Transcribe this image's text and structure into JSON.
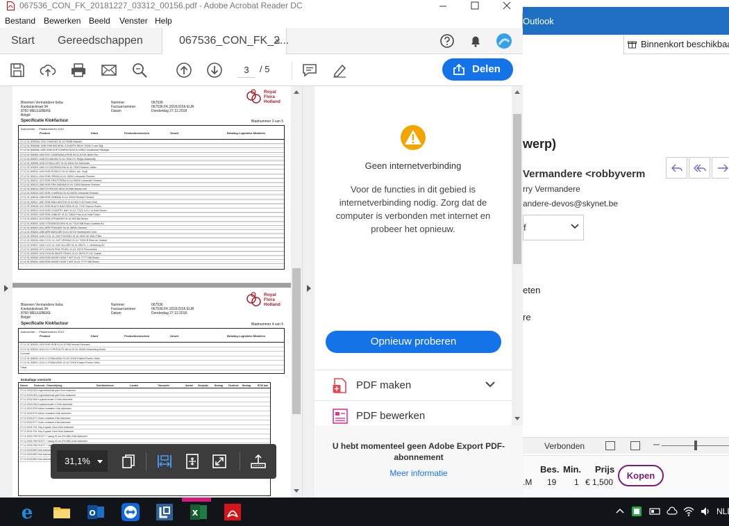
{
  "acrobat": {
    "window_title": "067536_CON_FK_20181227_03312_00156.pdf - Adobe Acrobat Reader DC",
    "menu": [
      "Bestand",
      "Bewerken",
      "Beeld",
      "Venster",
      "Help"
    ],
    "tabs": {
      "start": "Start",
      "tools": "Gereedschappen",
      "doc": "067536_CON_FK_2...",
      "close": "×"
    },
    "page": {
      "current": "3",
      "total": "/ 5"
    },
    "share_label": "Delen",
    "zoom": "31,1%"
  },
  "invoice": {
    "company": [
      "Bloemen Vermandere bvba",
      "Kastanjestraat 34",
      "8760 MEULEBEKE",
      "België"
    ],
    "meta_labels": [
      "Nummer",
      "Factuurnummer",
      "Datum"
    ],
    "meta_values": [
      "067536",
      "067536.FK.2018.0156 EUR",
      "Donderdag 27.12.2018"
    ],
    "title": "Specificatie Klokfactuur",
    "logo": [
      "Royal",
      "Flora",
      "Holland"
    ],
    "page1_label": "Bladnummer 3 van 5",
    "page2_label": "Bladnummer 4 van 5",
    "section_header": "Aanvoerder ... Plaatsnummer 2012",
    "col_groups": [
      "Product",
      "Klant",
      "Productkenmerken",
      "Omzet",
      "Betaling Logistieke Middelen"
    ],
    "rows_p1": [
      "27.12 01 005305a 1334 CHAM ADI 91 A2 90085 Markant",
      "27.12 01 005305b 1038 CHM NATURAL COUNTRY 88 A2 70006 C.van Gijlij",
      "27.12 01 005305c 1052 CHM CHP COMPACTA 92 A1 29512 Crudbenkel Flanegal",
      "27.12 01 005306 1054 ROC CAMPANULA PINK 83 A1 87101 Bella Flori",
      "27.12 01 005307 1048 CH MALIBU 91 A1 78410 Fr. Reijps Wasserdijl",
      "27.12 01 005308 1045 CH BALLURY 91 A1 84011 Bz Schreuder",
      "27.12 01 005309 1083 CH DOORBIDONA 91 A1 76000 Bekees Jablen",
      "27.12 01 005310 1039 ROB ROSECO 91 A1 80041 Jas. Oudji",
      "27.12 01 005311 1054 ROB ORNSA 91 A1 34000 Lebrandts Primees",
      "27.12 01 005312 1072 ROB FRA ETERNA 91 A1 86000 Lebrandts Primees",
      "27.12 01 005313 1062 ROB FRA SARANA 91 A1 13000 Bloemer Primees",
      "27.12 01 005314 1054 CH ROUGE 88 A1 84 Mali dansen bvb",
      "27.12 01 005315 1037 ROB CHAPEAU 91 A1 84000 Lebrandts Primees",
      "27.12 01 005316 1085 ROB ORBANA 91 A1 20000 Rinafiel Primees",
      "27.12 01 005317 1087 ROB WALLINGTON 91 A1 86171 B Flower Hold",
      "27.12 01 005318 1021 ROB BLACK BACCARA 91 A1 77047 Asmon Rosen",
      "27.12 01 005319 1019 ROB COUNTRY WAY 91 A1 77121 A.S.C et Holel Rosen",
      "27.12 01 005320 1030 ROB JUBILEE 91 A1 23600 Prad et al Holel Rosen",
      "27.12 01 005321 1013 ROB STRANGER 91 A1 803 Bal Rosen",
      "27.12 01 005322 1030 CTEDERION DRA 91 A1 73120 Bill Rose Goddess BV",
      "27.12 01 005323 1021 ARR FRAGANT 91 A1 28005 Osbrand",
      "27.12 01 005324 1086 ARR MARCARI 91 A1 92719 Vantenij den Oord",
      "27.12 01 005325 1046 CYCL KL SUP PICASSO 91 A1 5000 Ter Veen Plant",
      "27.12 01 005326 1081 CYCL KL SUP VERANO 91 A1 73000 B Elfan de Omstad",
      "27.12 01 005327 1030 CYCL KL SUP ALLURE 91 A1 283 P.L.J. Vederburg BV",
      "27.12 01 005328 1072 HYACIN PINK PEARL 91 A1 70070 Pinnenbeek",
      "27.12 01 005329 1015 HYACIN WHITE PEARL 91 A1 35370 R.J.M. Duinen",
      "27.12 01 005330 1009 ROB MONEY BOM T WIT 91 A1 77777 Bill Rosen",
      "27.12 01 005331 1009 ROB MONEY BOM T WIT 91 A1 77777 Bill Rosen"
    ],
    "rows_p2": [
      "27.12 01 005332 1020 ROB ROB 91 A1 87098 Hoeksij Denmark",
      "27.12 01 005333 1034 CH CYPER ALTS MELA 91 A1 30025 Gedenberg Kreek",
      "Correctie",
      "27.12 01 006520 1194 LI OTWALDING 91 A2 07400 Roland Florelo Vides",
      "27.12 01 006521 1194 LI OTWALDING 91 A2 07400 Roland Florelo Vides",
      "Totaal"
    ],
    "emb_title": "Emballage overzicht",
    "emb_cols": [
      "Datum",
      "Fustcode",
      "Omschrijving",
      "Distributiemod",
      "Locatie",
      "Transactie",
      "Aantal",
      "Stukprijs",
      "Bedrag",
      "Fustkost",
      "Bedrag",
      "BTW bas"
    ],
    "emb_rows": [
      "27.12.2018 003 Legendisvelzak gele Klok Aalsmeer",
      "27.12.2018 003 Legendisvelzak gele Klok Aalsmeer",
      "27.12.2018 006 Kopstukvonden 3 Klok Aalsmeer",
      "27.12.2018 006 Kopstukvonden 3 Klok Aalsmeer",
      "27.12.2018 578 Kleine container Klok Aalsmeer",
      "27.12.2018 573 Kleine container Klok Aalsmeer",
      "27.12.2018 577 Grote container Klok Aalsmeer",
      "27.12.2018 577 Grote container Klok Aalsmeer",
      "27.12.2018 794 Tray 6 gaats 13cm Klok Aalsmeer",
      "27.12.2018 794 Tray 6 gaats 13cm Klok Aalsmeer",
      "27.12.2018 795 FA 577 + stang 30 cm (Pe 880) Klok Aalsmeer",
      "27.12.2018 795 FA 577 + stang 30 cm (Pe 880) Klok Aalsmeer",
      "27.12.2018 795 FA 577 + stang 30 cm (Pe 880) Klok Aalsmeer",
      "27.12.2018 890 Klok Aalsmeer",
      "27.12.2018 890 Klok Aalsmeer",
      "27.12.2018 890 Klok Aalsmeer"
    ]
  },
  "panel": {
    "warning_title": "Geen internetverbinding",
    "warning_msg": "Voor de functies in dit gebied is internetverbinding nodig. Zorg dat de computer is verbonden met internet en probeer het opnieuw.",
    "retry_label": "Opnieuw proberen",
    "tools": [
      "PDF maken",
      "PDF bewerken"
    ],
    "subscription_note": "U hebt momenteel geen Adobe Export PDF-abonnement",
    "more_info": "Meer informatie"
  },
  "outlook": {
    "title": "Outlook",
    "info": "Binnenkort beschikbaa",
    "subject_fragment": "werp)",
    "sender_fragment": "Vermandere <robbyverm",
    "line1": "rry Vermandere",
    "line2": "andere-devos@skynet.be",
    "dropdown_value": "f",
    "word1": "eten",
    "word2": "re",
    "status": "Verbonden",
    "product_headers": [
      "Bes.",
      "Min.",
      "Prijs"
    ],
    "product_values": [
      ".M",
      "19",
      "1",
      "€ 1,500"
    ],
    "buy_label": "Kopen"
  },
  "taskbar": {
    "language": "NLD"
  },
  "colors": {
    "accent": "#1473e6",
    "outlook_blue": "#1e6fc2",
    "warning": "#f0a500",
    "buy_purple": "#7a1a79"
  }
}
